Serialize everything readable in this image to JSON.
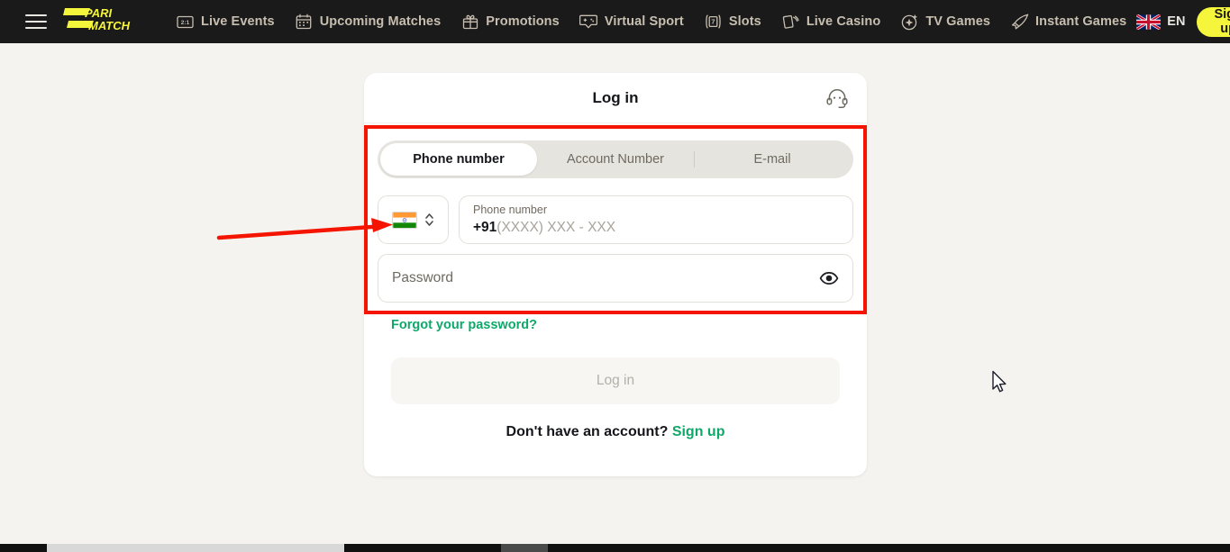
{
  "navbar": {
    "menu_icon": "hamburger-menu-icon",
    "brand": "PARIMATCH",
    "items": [
      {
        "label": "Live Events",
        "icon": "scoreboard-icon"
      },
      {
        "label": "Upcoming Matches",
        "icon": "calendar-icon"
      },
      {
        "label": "Promotions",
        "icon": "gift-icon"
      },
      {
        "label": "Virtual Sport",
        "icon": "gamepad-icon"
      },
      {
        "label": "Slots",
        "icon": "slot-machine-icon"
      },
      {
        "label": "Live Casino",
        "icon": "playing-cards-icon"
      },
      {
        "label": "TV Games",
        "icon": "sparkle-circle-icon"
      },
      {
        "label": "Instant Games",
        "icon": "rocket-icon"
      }
    ],
    "language": {
      "code": "EN",
      "flag": "uk-flag-icon"
    },
    "signup_label": "Sign up",
    "signup_color": "#f5f53c",
    "background": "#1a1a1a"
  },
  "login_card": {
    "title": "Log in",
    "support_icon": "headset-support-icon",
    "tabs": [
      {
        "label": "Phone number",
        "active": true
      },
      {
        "label": "Account Number",
        "active": false
      },
      {
        "label": "E-mail",
        "active": false
      }
    ],
    "country_select": {
      "flag": "india-flag-icon",
      "stepper_icon": "chevron-up-down-icon"
    },
    "phone_field": {
      "label": "Phone number",
      "country_code": "+91",
      "placeholder": "(XXXX) XXX - XXX"
    },
    "password_field": {
      "placeholder": "Password",
      "toggle_icon": "eye-icon"
    },
    "forgot_password": "Forgot your password?",
    "login_button": "Log in",
    "footer_text": "Don't have an account?",
    "footer_link": "Sign up",
    "accent_green": "#0ea96a"
  },
  "annotations": {
    "highlight_box_color": "#f51400",
    "arrow_color": "#f51400"
  },
  "page": {
    "background": "#f4f3ef"
  }
}
